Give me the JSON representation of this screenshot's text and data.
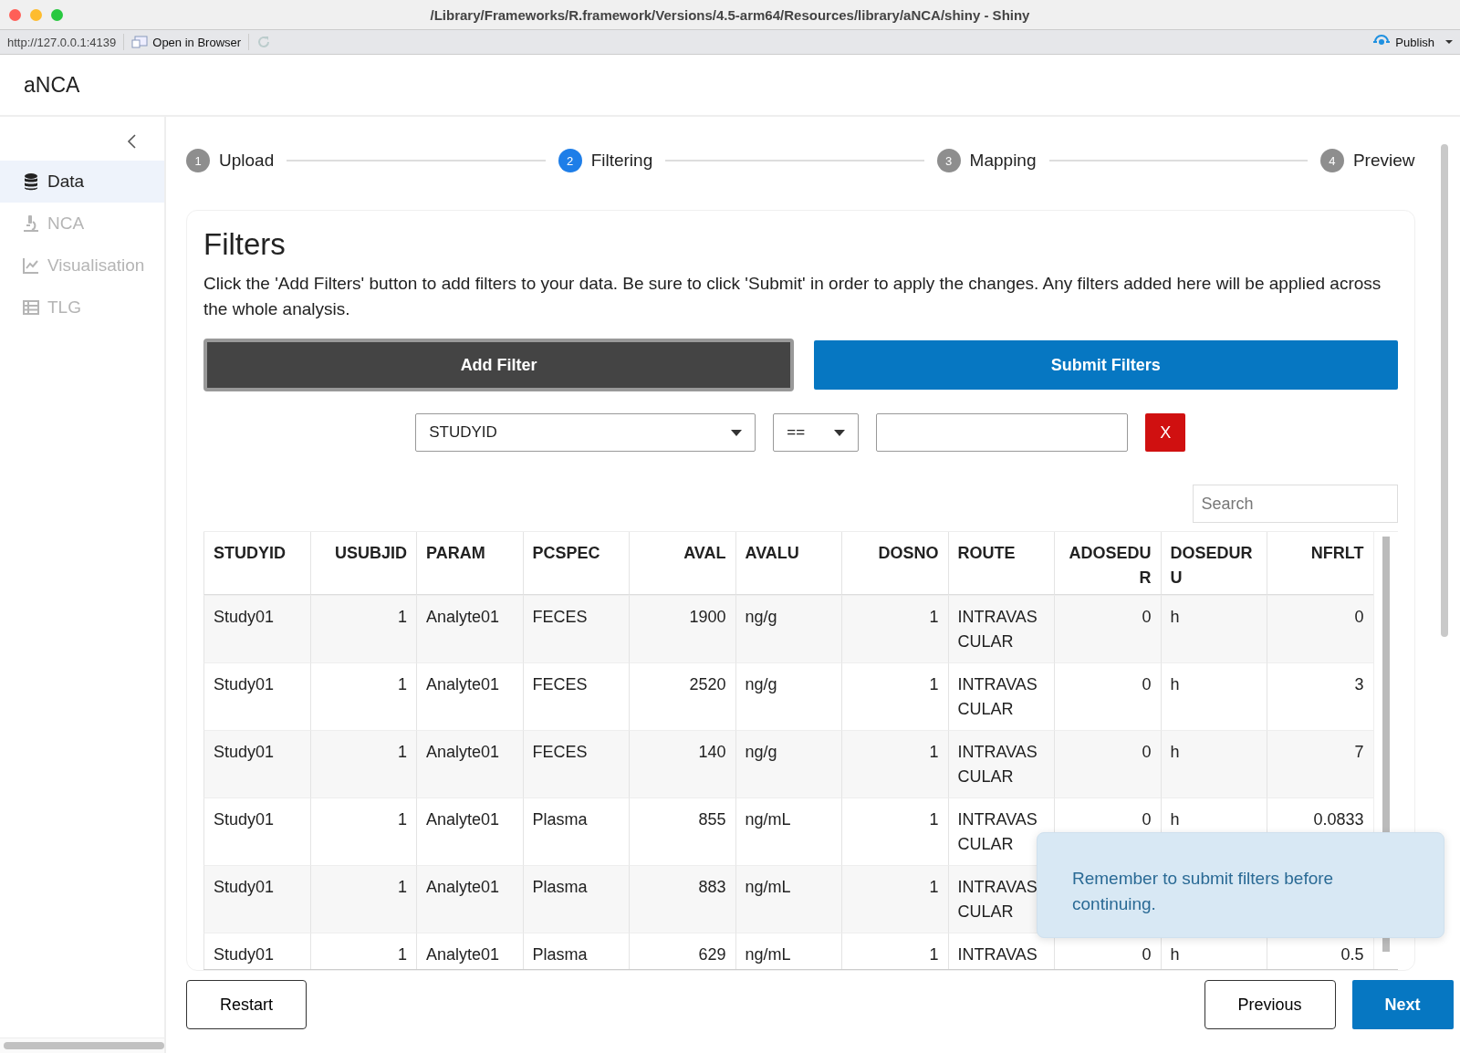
{
  "window": {
    "title": "/Library/Frameworks/R.framework/Versions/4.5-arm64/Resources/library/aNCA/shiny - Shiny"
  },
  "toolbar": {
    "url": "http://127.0.0.1:4139",
    "open_in_browser": "Open in Browser",
    "publish": "Publish"
  },
  "app": {
    "title": "aNCA"
  },
  "sidebar": {
    "items": [
      {
        "label": "Data",
        "selected": true,
        "disabled": false
      },
      {
        "label": "NCA",
        "selected": false,
        "disabled": true
      },
      {
        "label": "Visualisation",
        "selected": false,
        "disabled": true
      },
      {
        "label": "TLG",
        "selected": false,
        "disabled": true
      }
    ]
  },
  "stepper": [
    {
      "number": "1",
      "label": "Upload",
      "selected": false
    },
    {
      "number": "2",
      "label": "Filtering",
      "selected": true
    },
    {
      "number": "3",
      "label": "Mapping",
      "selected": false
    },
    {
      "number": "4",
      "label": "Preview",
      "selected": false
    }
  ],
  "filters": {
    "heading": "Filters",
    "description": "Click the 'Add Filters' button to add filters to your data. Be sure to click 'Submit' in order to apply the changes. Any filters added here will be applied across the whole analysis.",
    "add_button": "Add Filter",
    "submit_button": "Submit Filters",
    "column_select": "STUDYID",
    "operator_select": "==",
    "remove_button": "X"
  },
  "search": {
    "placeholder": "Search"
  },
  "table": {
    "columns": [
      {
        "label": "STUDYID",
        "kind": "text"
      },
      {
        "label": "USUBJID",
        "kind": "number"
      },
      {
        "label": "PARAM",
        "kind": "text"
      },
      {
        "label": "PCSPEC",
        "kind": "text"
      },
      {
        "label": "AVAL",
        "kind": "number"
      },
      {
        "label": "AVALU",
        "kind": "text"
      },
      {
        "label": "DOSNO",
        "kind": "number"
      },
      {
        "label": "ROUTE",
        "kind": "text"
      },
      {
        "label": "ADOSEDUR",
        "kind": "number"
      },
      {
        "label": "DOSEDURU",
        "kind": "text"
      },
      {
        "label": "NFRLT",
        "kind": "number"
      }
    ],
    "rows": [
      [
        "Study01",
        "1",
        "Analyte01",
        "FECES",
        "1900",
        "ng/g",
        "1",
        "INTRAVASCULAR",
        "0",
        "h",
        "0"
      ],
      [
        "Study01",
        "1",
        "Analyte01",
        "FECES",
        "2520",
        "ng/g",
        "1",
        "INTRAVASCULAR",
        "0",
        "h",
        "3"
      ],
      [
        "Study01",
        "1",
        "Analyte01",
        "FECES",
        "140",
        "ng/g",
        "1",
        "INTRAVASCULAR",
        "0",
        "h",
        "7"
      ],
      [
        "Study01",
        "1",
        "Analyte01",
        "Plasma",
        "855",
        "ng/mL",
        "1",
        "INTRAVASCULAR",
        "0",
        "h",
        "0.0833"
      ],
      [
        "Study01",
        "1",
        "Analyte01",
        "Plasma",
        "883",
        "ng/mL",
        "1",
        "INTRAVASCULAR"
      ],
      [
        "Study01",
        "1",
        "Analyte01",
        "Plasma",
        "629",
        "ng/mL",
        "1",
        "INTRAVAS",
        "0",
        "h",
        "0.5"
      ]
    ]
  },
  "toast": {
    "message": "Remember to submit filters before continuing."
  },
  "nav": {
    "restart": "Restart",
    "previous": "Previous",
    "next": "Next"
  }
}
